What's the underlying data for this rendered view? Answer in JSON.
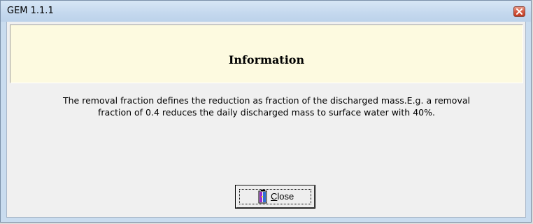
{
  "window": {
    "title": "GEM 1.1.1",
    "close_icon": "close-x-icon"
  },
  "header": {
    "title": "Information",
    "background": "#fdfae0"
  },
  "message": {
    "line1": "The removal fraction defines the reduction as fraction of the discharged mass.E.g. a removal",
    "line2": "fraction of 0.4 reduces the daily discharged mass to surface water with 40%."
  },
  "buttons": {
    "close": {
      "mnemonic": "C",
      "rest": "lose",
      "icon": "door-exit-icon"
    }
  },
  "colors": {
    "titlebar": "#c4d8ee",
    "close_x": "#d45a43",
    "client": "#f0f0f0"
  }
}
